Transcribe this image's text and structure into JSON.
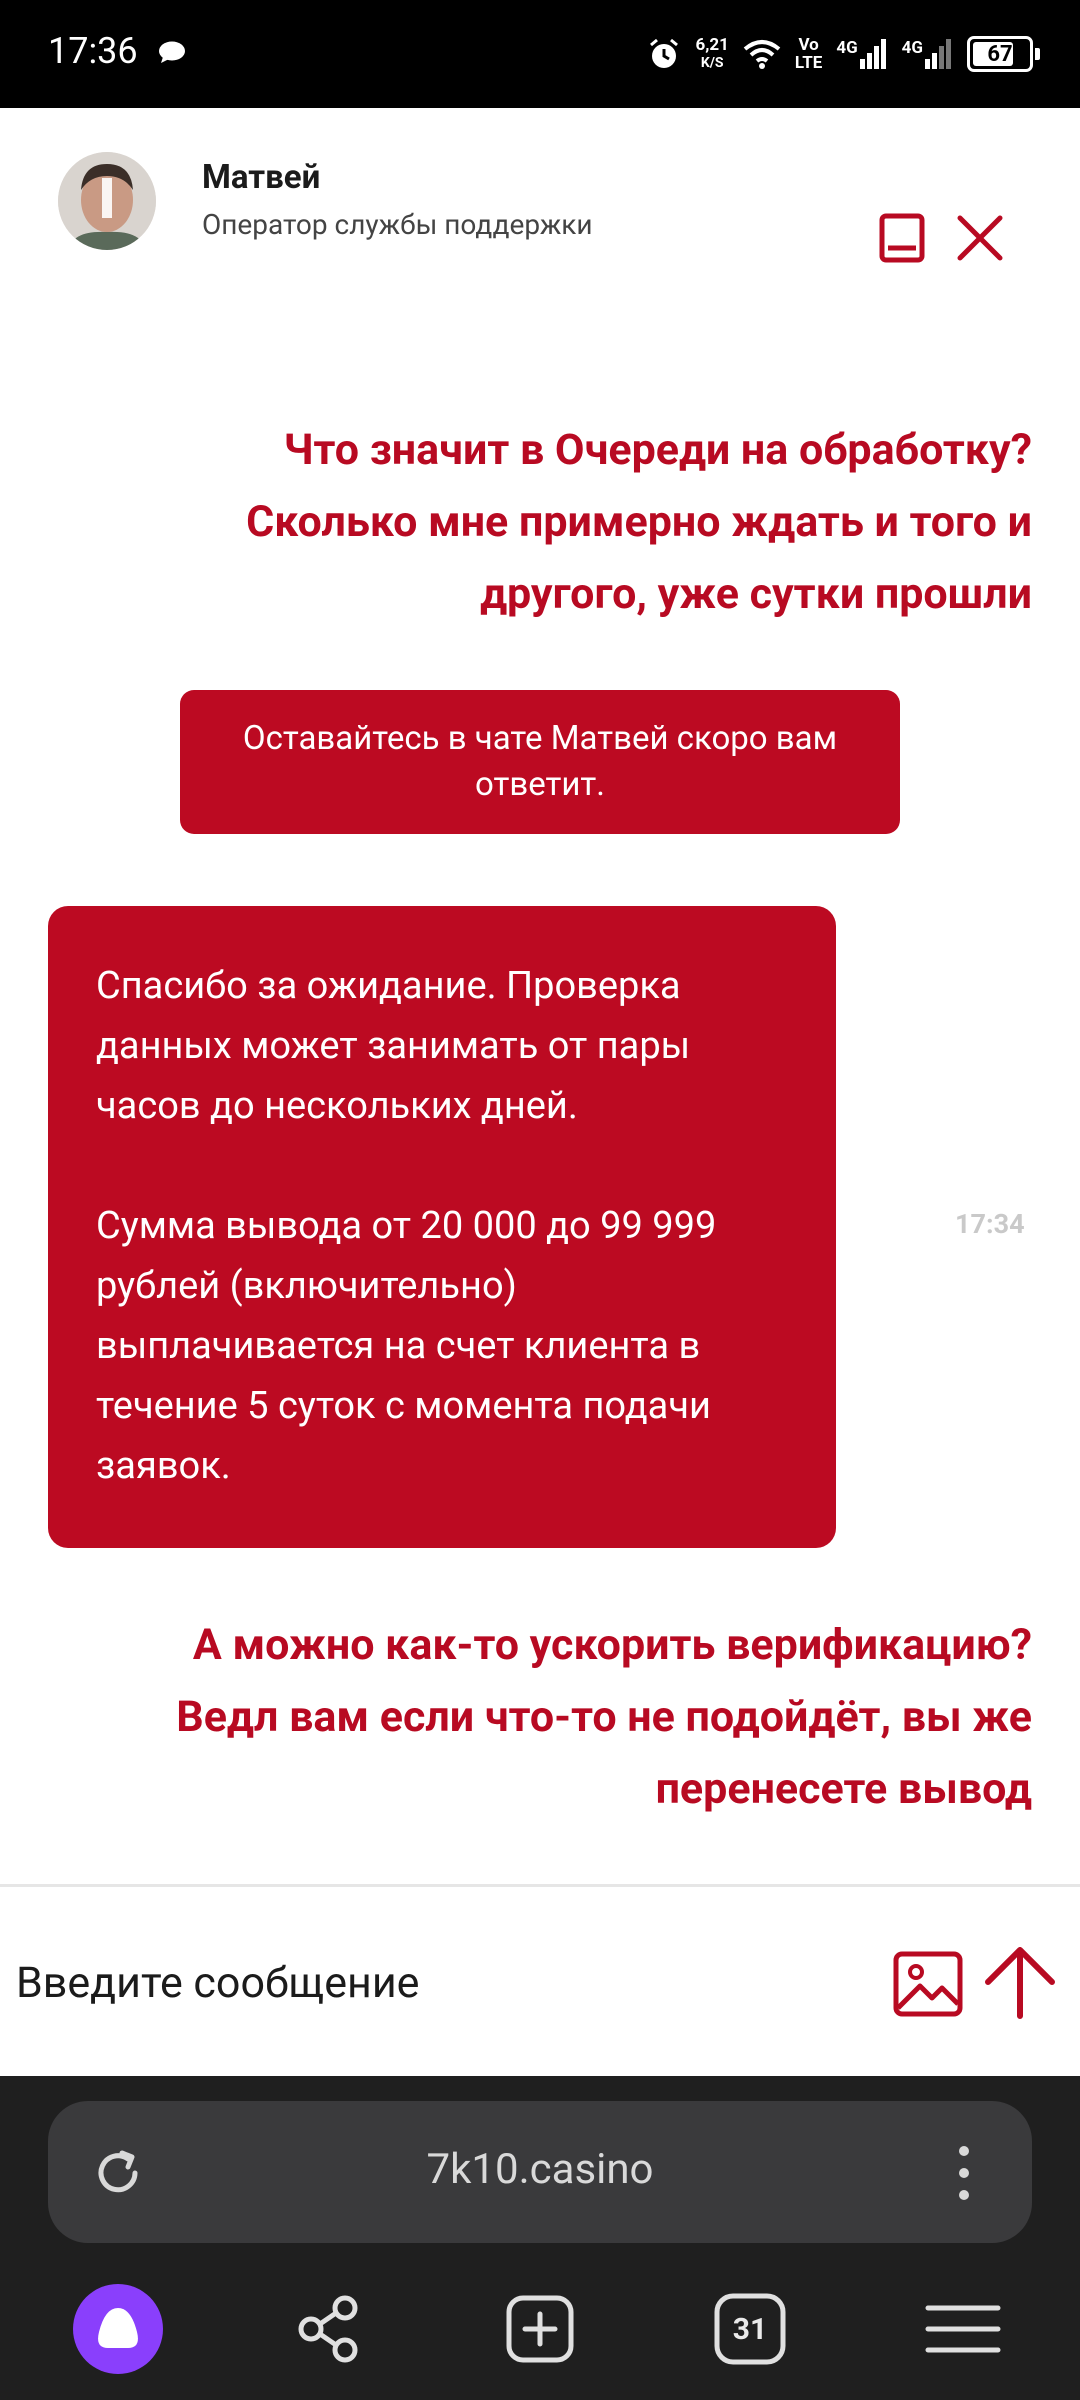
{
  "status_bar": {
    "time": "17:36",
    "net_speed_value": "6,21",
    "net_speed_unit": "K/S",
    "volte_top": "Vo",
    "volte_bottom": "LTE",
    "sim1_label": "4G",
    "sim2_label": "4G",
    "battery": "67"
  },
  "header": {
    "operator_name": "Матвей",
    "operator_role": "Оператор службы поддержки",
    "minimize_icon": "minimize-icon",
    "close_icon": "close-icon"
  },
  "messages": {
    "user_1": {
      "line_1": "Что значит в Очереди на обработку?",
      "line_2": "Сколько мне примерно ждать и того и",
      "line_3": "другого, уже сутки прошли"
    },
    "system_notice": "Оставайтесь в чате Матвей скоро вам ответит.",
    "operator_reply": {
      "paragraph_1": "Спасибо за ожидание. Проверка данных может занимать от пары часов до нескольких дней.",
      "paragraph_2": "Сумма вывода от 20 000 до 99 999 рублей (включительно) выплачивается на счет клиента в течение 5 суток с момента подачи заявок.",
      "time": "17:34"
    },
    "user_2": {
      "line_1": "А можно как-то ускорить верификацию?",
      "line_2": "Ведл вам если что-то не подойдёт, вы же",
      "line_3": "перенесете вывод"
    }
  },
  "input": {
    "placeholder": "Введите сообщение",
    "attach_icon": "image-icon",
    "send_icon": "arrow-up-icon"
  },
  "browser": {
    "url": "7k10.casino",
    "tabs_count": "31",
    "colors": {
      "accent": "#bc0a22",
      "chrome_bg": "#1f1f1f",
      "alice": "#8a3ffc"
    }
  }
}
